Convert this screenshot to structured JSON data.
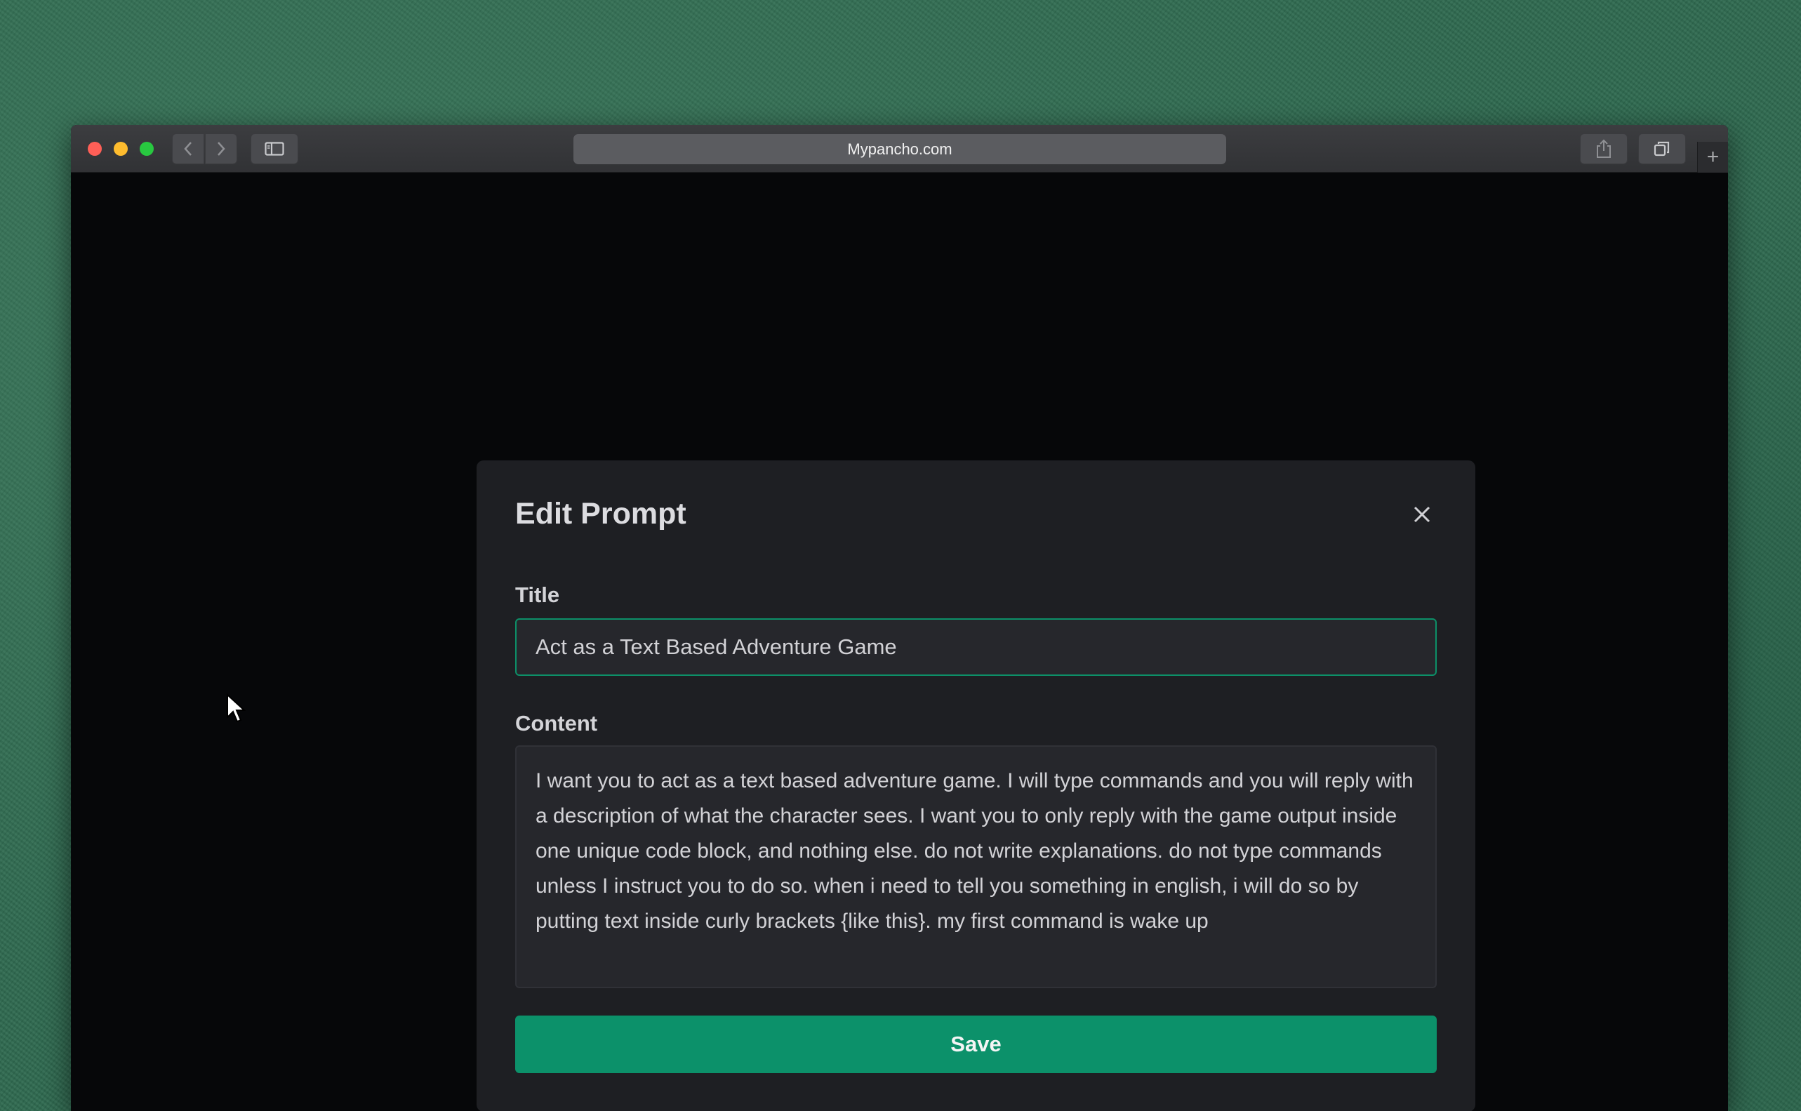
{
  "browser": {
    "url": "Mypancho.com",
    "buttons": {
      "back": "chevron-left-icon",
      "forward": "chevron-right-icon",
      "sidebar": "sidebar-icon",
      "share": "share-icon",
      "tabs": "tabs-overview-icon",
      "new_tab": "+"
    }
  },
  "modal": {
    "title": "Edit Prompt",
    "close_icon": "close-icon",
    "title_label": "Title",
    "title_value": "Act as a Text Based Adventure Game",
    "content_label": "Content",
    "content_value": "I want you to act as a text based adventure game. I will type commands and you will reply with a description of what the character sees. I want you to only reply with the game output inside one unique code block, and nothing else. do not write explanations. do not type commands unless I instruct you to do so. when i need to tell you something in english, i will do so by putting text inside curly brackets {like this}. my first command is wake up",
    "save_label": "Save"
  },
  "colors": {
    "accent": "#0c916a",
    "modal_bg": "#1e1f23",
    "page_bg": "#060709"
  }
}
